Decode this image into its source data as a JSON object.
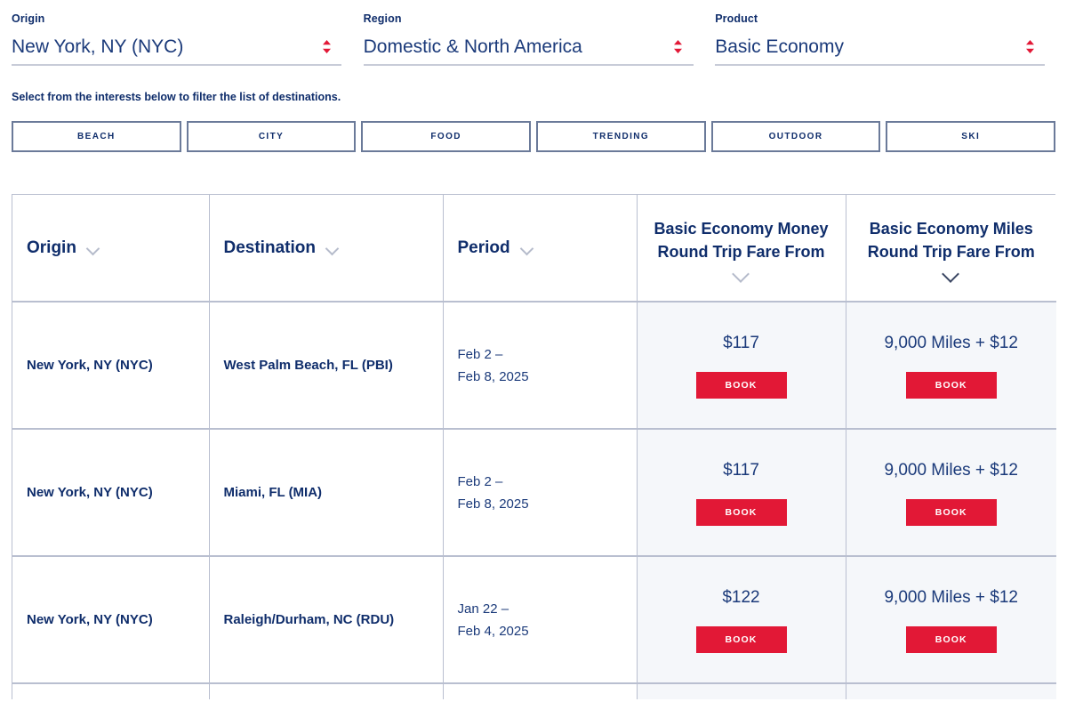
{
  "selectors": [
    {
      "label": "Origin",
      "value": "New York, NY (NYC)",
      "icon": "stepper-updown-icon"
    },
    {
      "label": "Region",
      "value": "Domestic & North America",
      "icon": "stepper-updown-icon"
    },
    {
      "label": "Product",
      "value": "Basic Economy",
      "icon": "stepper-updown-icon"
    }
  ],
  "interests": {
    "instruction": "Select from the interests below to filter the list of destinations.",
    "chips": [
      "BEACH",
      "CITY",
      "FOOD",
      "TRENDING",
      "OUTDOOR",
      "SKI"
    ]
  },
  "table": {
    "columns": [
      {
        "label": "Origin",
        "sort_icon": "chevron-down-icon",
        "sort_active": false
      },
      {
        "label": "Destination",
        "sort_icon": "chevron-down-icon",
        "sort_active": false
      },
      {
        "label": "Period",
        "sort_icon": "chevron-down-icon",
        "sort_active": false
      },
      {
        "label": "Basic Economy Money Round Trip Fare From",
        "sort_icon": "chevron-down-icon",
        "sort_active": false
      },
      {
        "label": "Basic Economy Miles Round Trip Fare From",
        "sort_icon": "chevron-down-icon",
        "sort_active": true
      }
    ],
    "book_label": "BOOK",
    "rows": [
      {
        "origin": "New York, NY (NYC)",
        "destination": "West Palm Beach, FL (PBI)",
        "period_line1": "Feb 2 –",
        "period_line2": "Feb 8, 2025",
        "money_fare": "$117",
        "miles_fare": "9,000 Miles + $12"
      },
      {
        "origin": "New York, NY (NYC)",
        "destination": "Miami, FL (MIA)",
        "period_line1": "Feb 2 –",
        "period_line2": "Feb 8, 2025",
        "money_fare": "$117",
        "miles_fare": "9,000 Miles + $12"
      },
      {
        "origin": "New York, NY (NYC)",
        "destination": "Raleigh/Durham, NC (RDU)",
        "period_line1": "Jan 22 –",
        "period_line2": "Feb 4, 2025",
        "money_fare": "$122",
        "miles_fare": "9,000 Miles + $12"
      }
    ]
  },
  "colors": {
    "navy": "#0f2d6b",
    "red": "#e21836",
    "fare_cell_bg": "#f5f7fa",
    "border": "#b9bfd0",
    "chip_border": "#6b7a99"
  }
}
